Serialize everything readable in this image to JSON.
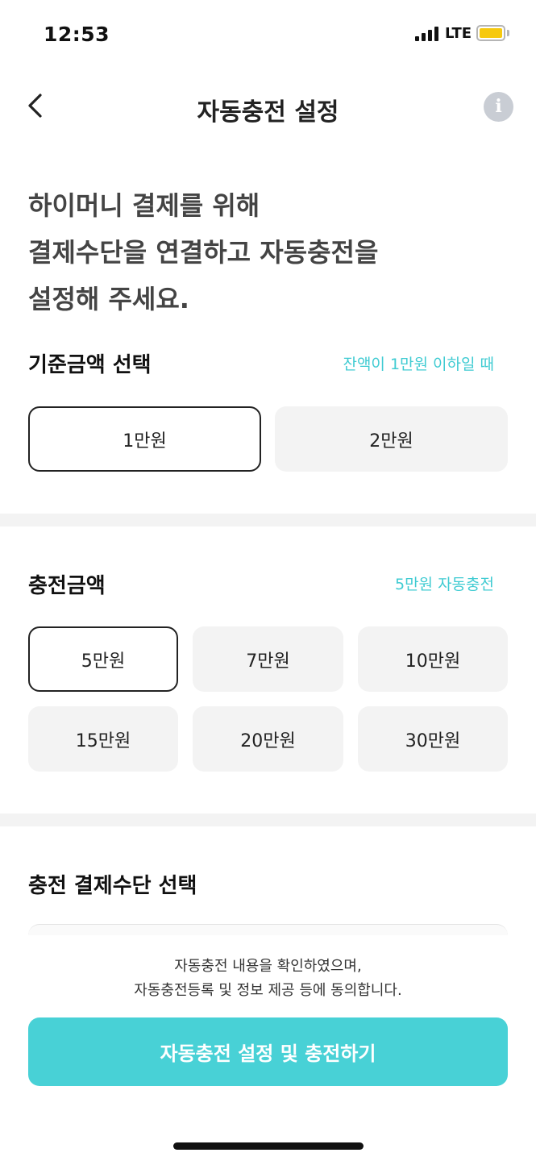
{
  "status_bar": {
    "time": "12:53",
    "network": "LTE",
    "battery_color": "#f6c90e"
  },
  "nav": {
    "title": "자동충전 설정",
    "back_icon": "chevron-left-icon",
    "info_icon": "info-icon",
    "info_glyph": "i"
  },
  "headline": {
    "lines": [
      "하이머니 결제를 위해",
      "결제수단을 연결하고 자동충전을",
      "설정해 주세요."
    ]
  },
  "threshold": {
    "title": "기준금액 선택",
    "hint": "잔액이 1만원 이하일 때",
    "options": [
      {
        "label": "1만원",
        "selected": true
      },
      {
        "label": "2만원",
        "selected": false
      }
    ]
  },
  "charge": {
    "title": "충전금액",
    "hint": "5만원 자동충전",
    "options": [
      {
        "label": "5만원",
        "selected": true
      },
      {
        "label": "7만원",
        "selected": false
      },
      {
        "label": "10만원",
        "selected": false
      },
      {
        "label": "15만원",
        "selected": false
      },
      {
        "label": "20만원",
        "selected": false
      },
      {
        "label": "30만원",
        "selected": false
      }
    ]
  },
  "payment": {
    "title": "충전 결제수단 선택"
  },
  "footer": {
    "agreement_line1": "자동충전 내용을 확인하였으며,",
    "agreement_line2": "자동충전등록 및 정보 제공 등에 동의합니다.",
    "submit_label": "자동충전 설정 및 충전하기",
    "accent_color": "#48d1d6"
  }
}
